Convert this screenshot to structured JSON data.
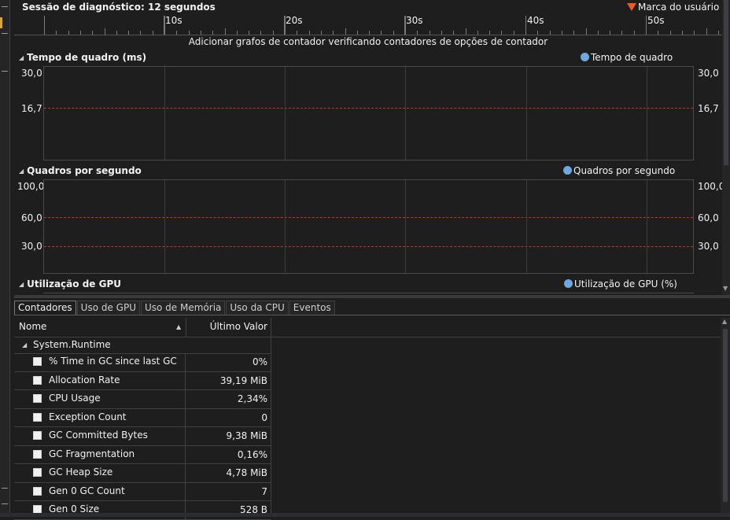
{
  "session": {
    "title": "Sessão de diagnóstico: 12 segundos",
    "user_mark_label": "Marca do usuário",
    "user_mark_color": "#f05a23"
  },
  "timeline": {
    "labels": [
      "10s",
      "20s",
      "30s",
      "40s",
      "50s"
    ]
  },
  "hint": "Adicionar grafos de contador verificando contadores de opções de contador",
  "sections": {
    "frame_time": {
      "title": "Tempo de quadro (ms)",
      "legend": "Tempo de quadro",
      "y_top": "30,0",
      "y_mid": "16,7"
    },
    "fps": {
      "title": "Quadros por segundo",
      "legend": "Quadros por segundo",
      "y_top": "100,0",
      "y_mid": "60,0",
      "y_low": "30,0"
    },
    "gpu": {
      "title": "Utilização de GPU",
      "legend": "Utilização de GPU (%)"
    }
  },
  "colors": {
    "legend_dot": "#6fa8dc",
    "threshold_line": "#c8322d"
  },
  "tabs": [
    "Contadores",
    "Uso de GPU",
    "Uso de Memória",
    "Uso da CPU",
    "Eventos"
  ],
  "grid": {
    "col_name": "Nome",
    "col_value": "Último Valor",
    "group": "System.Runtime",
    "rows": [
      {
        "name": "% Time in GC since last GC",
        "value": "0%"
      },
      {
        "name": "Allocation Rate",
        "value": "39,19 MiB"
      },
      {
        "name": "CPU Usage",
        "value": "2,34%"
      },
      {
        "name": "Exception Count",
        "value": "0"
      },
      {
        "name": "GC Committed Bytes",
        "value": "9,38 MiB"
      },
      {
        "name": "GC Fragmentation",
        "value": "0,16%"
      },
      {
        "name": "GC Heap Size",
        "value": "4,78 MiB"
      },
      {
        "name": "Gen 0 GC Count",
        "value": "7"
      },
      {
        "name": "Gen 0 Size",
        "value": "528 B"
      }
    ]
  }
}
